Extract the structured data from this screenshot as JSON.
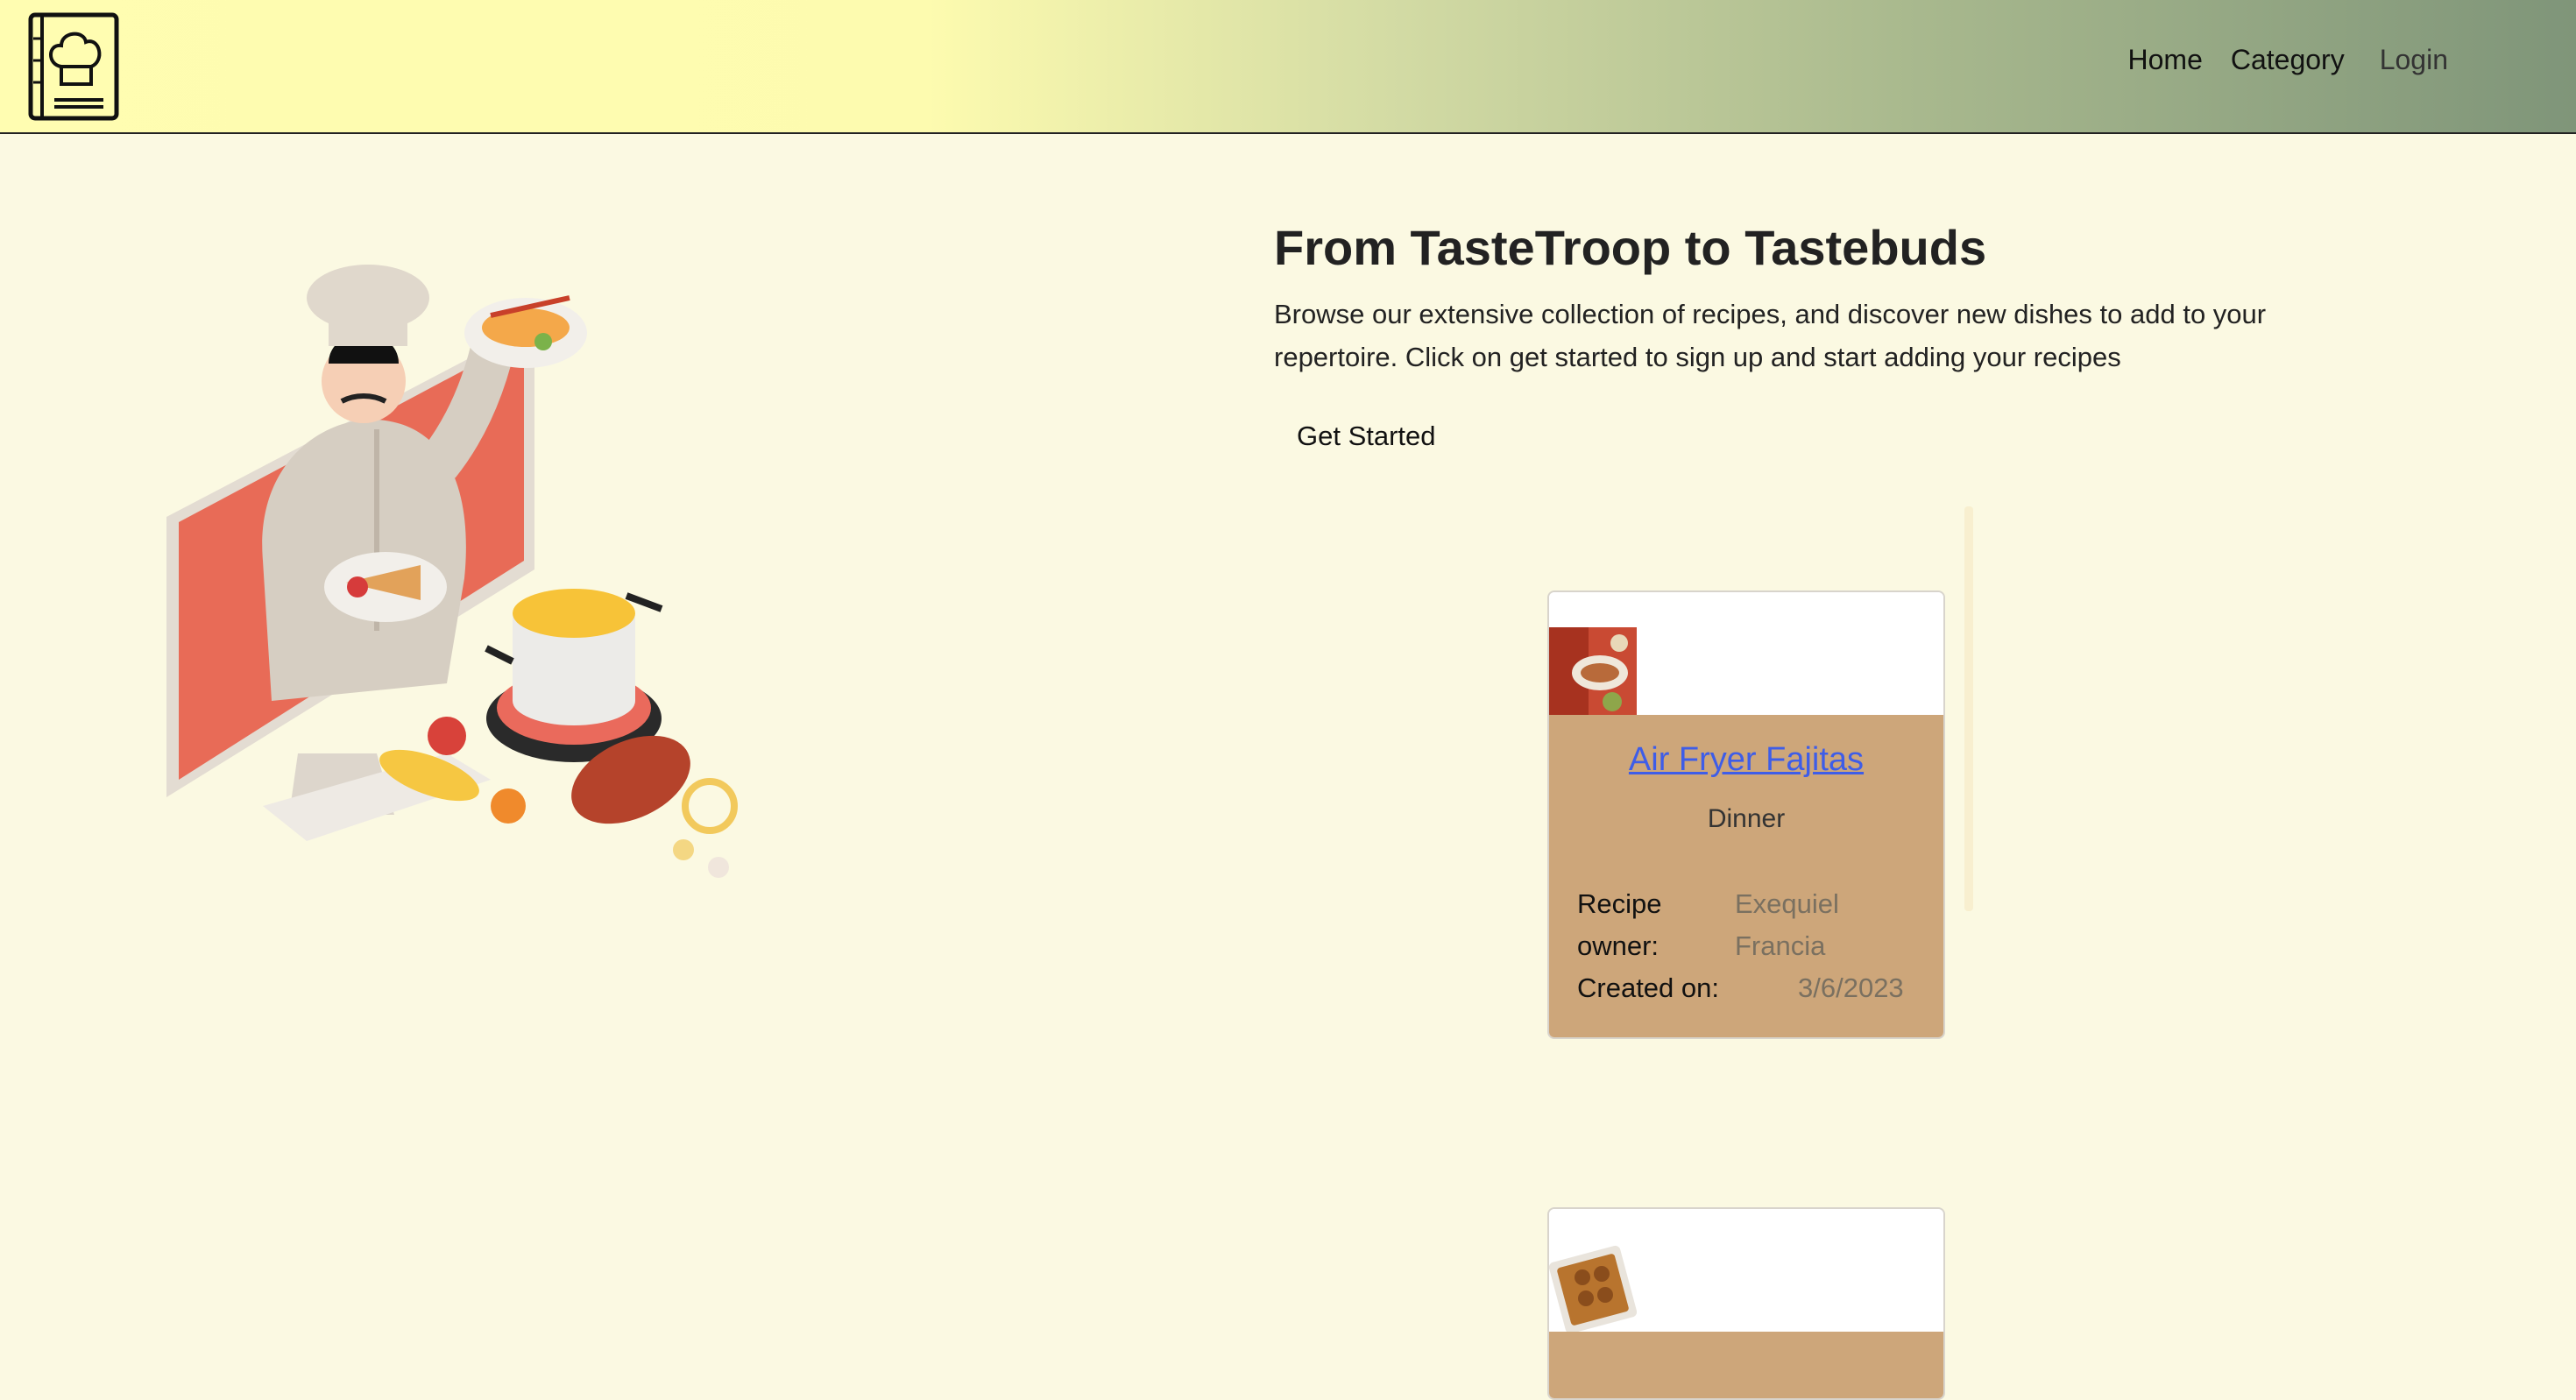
{
  "nav": {
    "logo_icon": "chef-cookbook-icon",
    "links": [
      "Home",
      "Category",
      "Login"
    ]
  },
  "hero": {
    "title": "From TasteTroop to Tastebuds",
    "subtitle": "Browse our extensive collection of recipes, and discover new dishes to add to your repertoire. Click on get started to sign up and start adding your recipes",
    "cta": "Get Started",
    "illustration_icon": "chef-illustration"
  },
  "recipes": [
    {
      "title": "Air Fryer Fajitas",
      "category": "Dinner",
      "owner_label_1": "Recipe",
      "owner_label_2": "owner:",
      "owner_first": "Exequiel",
      "owner_last": "Francia",
      "created_label": "Created on:",
      "created_on": "3/6/2023"
    },
    {
      "thumb_icon": "baked-dish-icon"
    }
  ],
  "colors": {
    "page_bg": "#fbf9e2",
    "card_body": "#cda67a",
    "link": "#3e5de8",
    "nav_start": "#fffdb1",
    "nav_end": "#7f9579"
  }
}
